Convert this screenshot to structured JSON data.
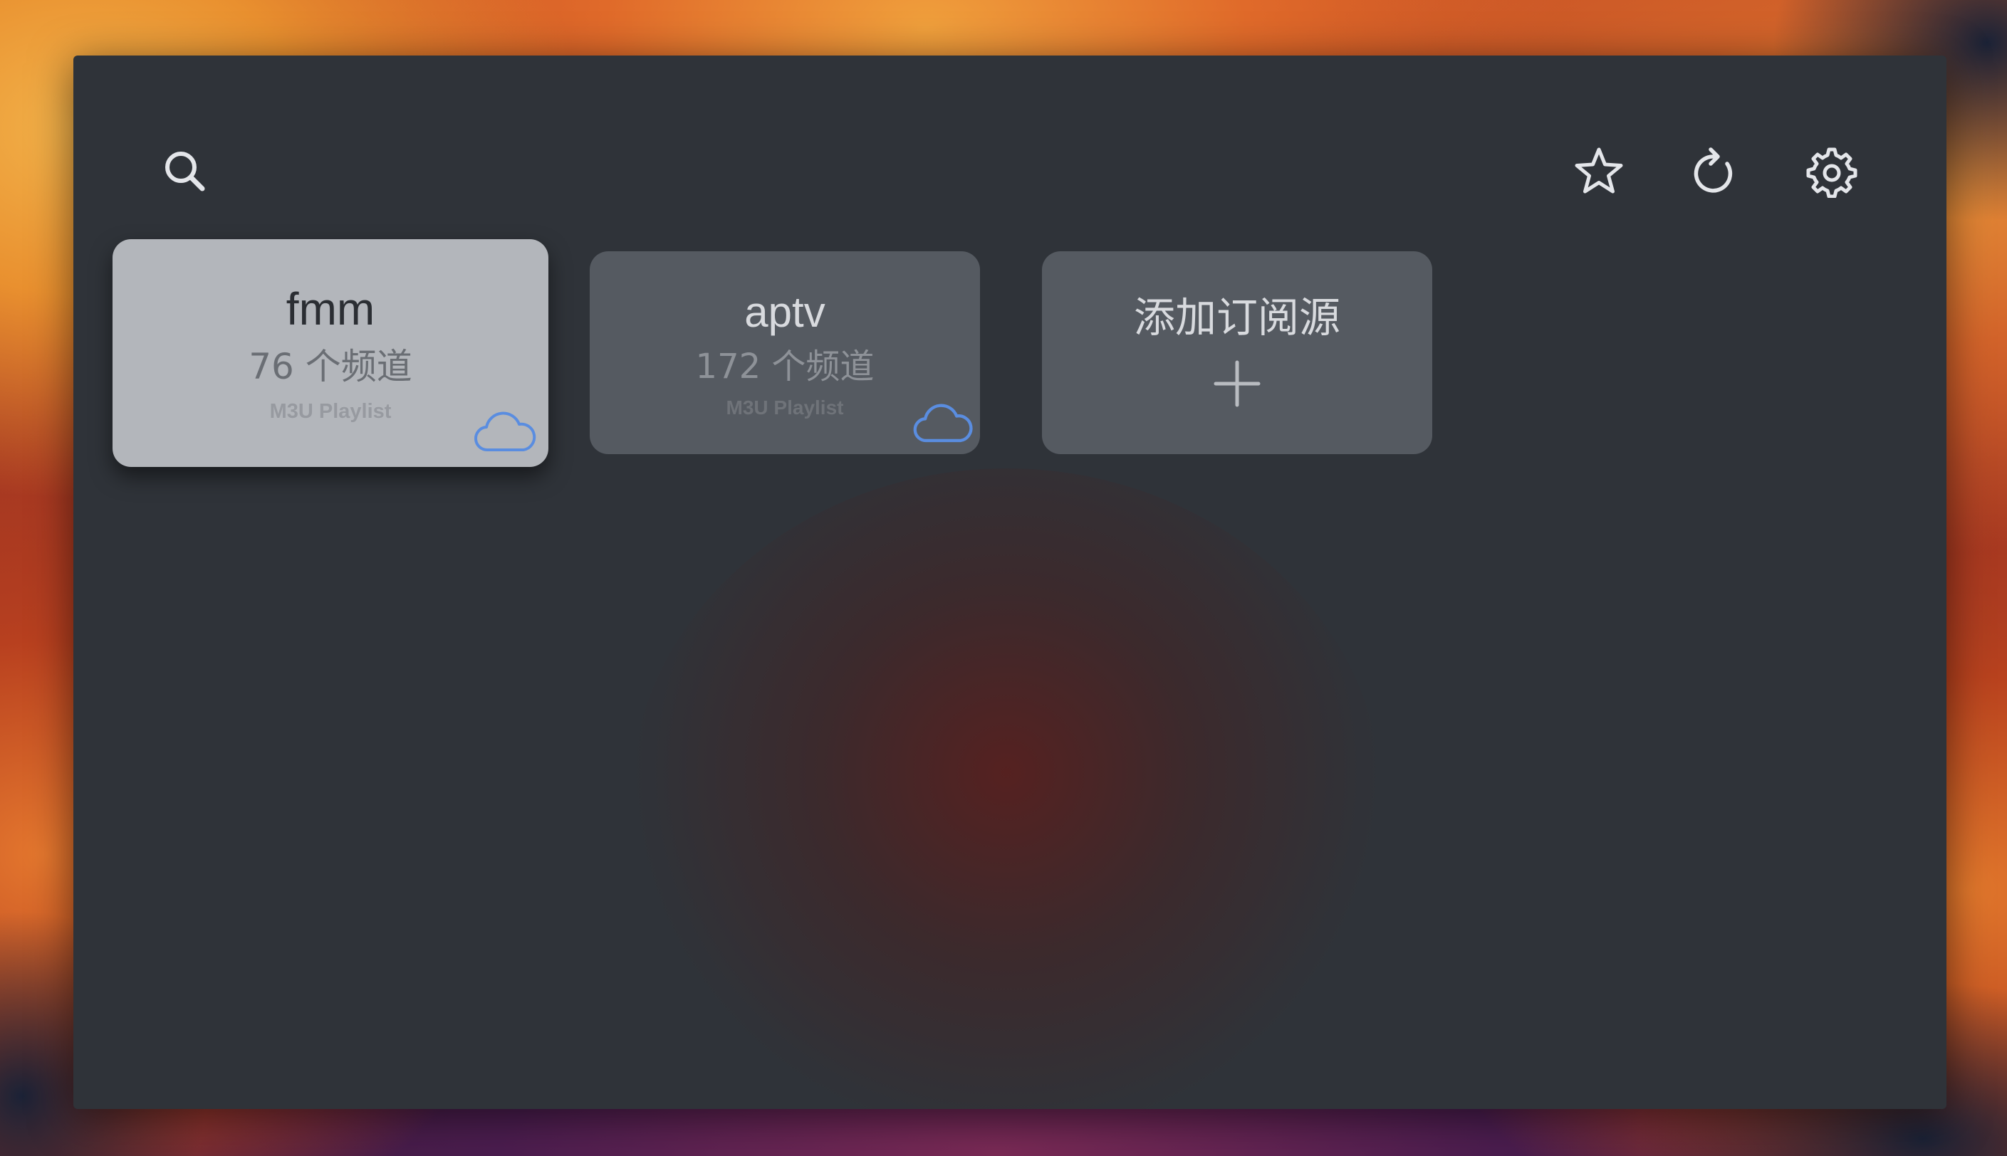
{
  "toolbar": {
    "search_icon": "search-icon",
    "favorites_icon": "star-icon",
    "refresh_icon": "refresh-icon",
    "settings_icon": "gear-icon"
  },
  "sources": [
    {
      "name": "fmm",
      "count": "76 个频道",
      "type": "M3U Playlist",
      "icon": "cloud-icon",
      "focused": true
    },
    {
      "name": "aptv",
      "count": "172 个频道",
      "type": "M3U Playlist",
      "icon": "cloud-icon",
      "focused": false
    }
  ],
  "add_source": {
    "label": "添加订阅源",
    "icon": "plus-icon"
  },
  "colors": {
    "window_bg": "#2f3339",
    "card_focused_bg": "#b3b6bb",
    "card_bg": "#555a61",
    "cloud_accent": "#5a8de0"
  }
}
